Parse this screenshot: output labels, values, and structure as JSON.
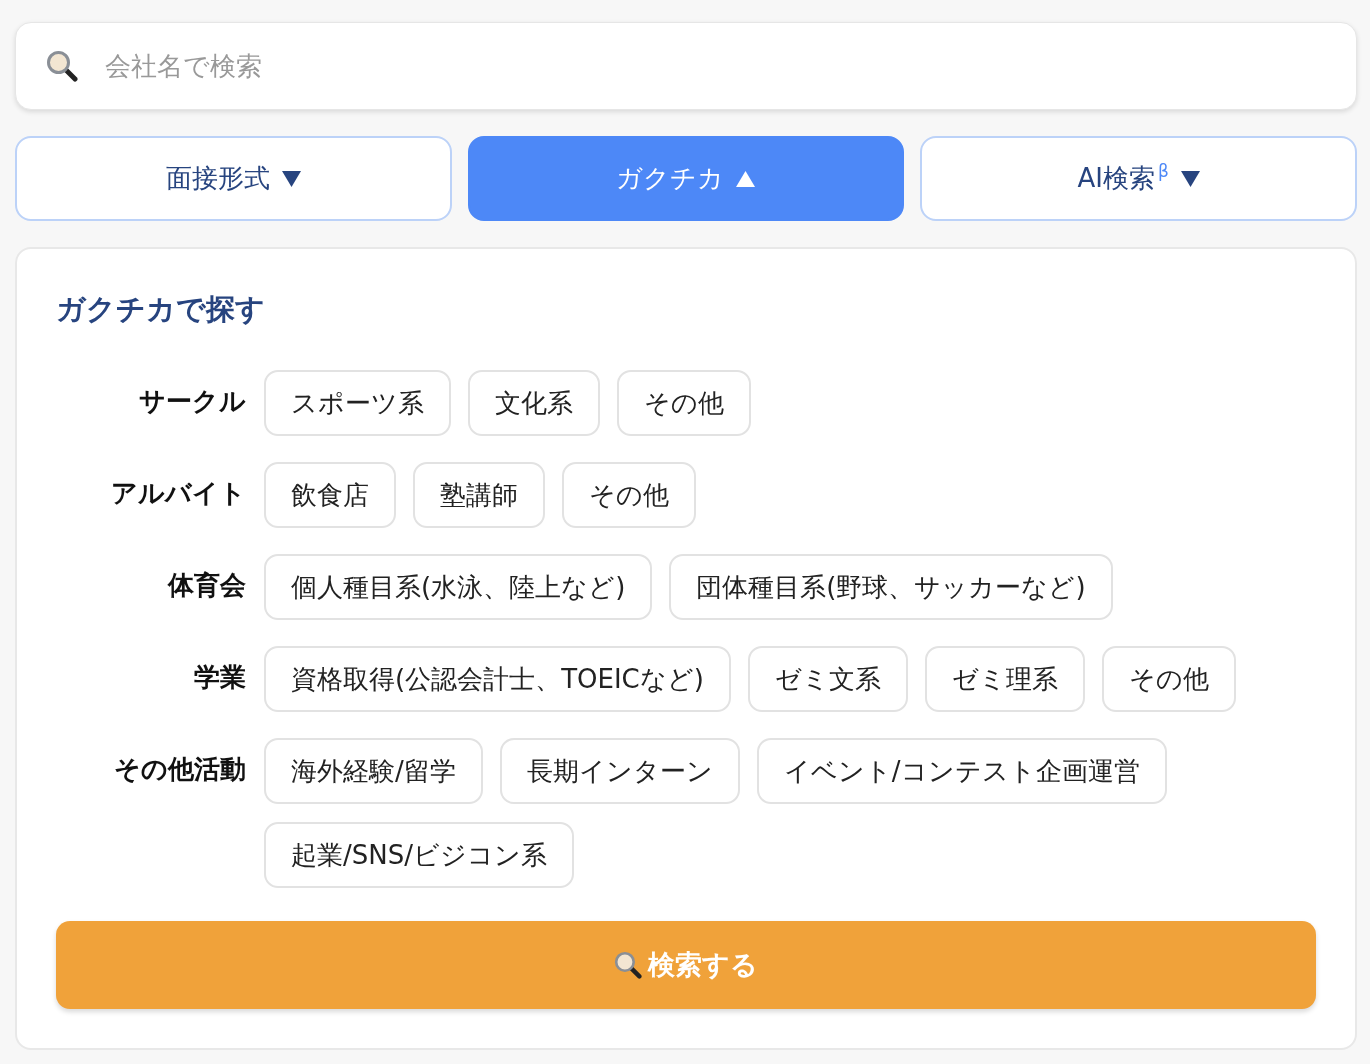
{
  "search_field": {
    "placeholder": "会社名で検索"
  },
  "tabs": [
    {
      "label": "面接形式",
      "selected": false,
      "expanded": false
    },
    {
      "label": "ガクチカ",
      "selected": true,
      "expanded": true
    },
    {
      "label": "AI検索$^{β}$",
      "selected": false,
      "expanded": false
    }
  ],
  "panel": {
    "title": "ガクチカで探す",
    "categories": [
      {
        "label": "サークル",
        "options": [
          {
            "label": "スポーツ系",
            "selected": false
          },
          {
            "label": "文化系",
            "selected": false
          },
          {
            "label": "その他",
            "selected": false
          }
        ]
      },
      {
        "label": "アルバイト",
        "options": [
          {
            "label": "飲食店",
            "selected": false
          },
          {
            "label": "塾講師",
            "selected": false
          },
          {
            "label": "その他",
            "selected": false
          }
        ]
      },
      {
        "label": "体育会",
        "options": [
          {
            "label": "個人種目系(水泳、陸上など)",
            "selected": false
          },
          {
            "label": "団体種目系(野球、サッカーなど)",
            "selected": false
          }
        ]
      },
      {
        "label": "学業",
        "options": [
          {
            "label": "資格取得(公認会計士、TOEICなど)",
            "selected": false
          },
          {
            "label": "ゼミ文系",
            "selected": false
          },
          {
            "label": "ゼミ理系",
            "selected": false
          },
          {
            "label": "その他",
            "selected": false
          }
        ]
      },
      {
        "label": "その他活動",
        "options": [
          {
            "label": "海外経験/留学",
            "selected": false
          },
          {
            "label": "長期インターン",
            "selected": false
          },
          {
            "label": "イベント/コンテスト企画運営",
            "selected": false
          },
          {
            "label": "起業/SNS/ビジコン系",
            "selected": false
          }
        ]
      }
    ],
    "search_button": {
      "label": "検索する"
    }
  }
}
